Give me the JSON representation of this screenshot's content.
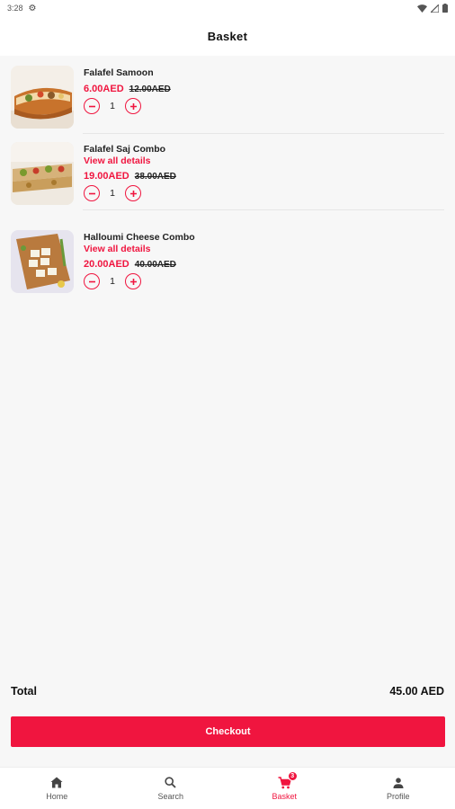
{
  "status_bar": {
    "time": "3:28"
  },
  "header": {
    "title": "Basket"
  },
  "items": [
    {
      "name": "Falafel Samoon",
      "details": "",
      "price": "6.00AED",
      "old_price": "12.00AED",
      "qty": "1",
      "image": "falafel-samoon-image"
    },
    {
      "name": "Falafel Saj Combo",
      "details": "View all details",
      "price": "19.00AED",
      "old_price": "38.00AED",
      "qty": "1",
      "image": "falafel-saj-combo-image"
    },
    {
      "name": "Halloumi Cheese Combo",
      "details": "View all details",
      "price": "20.00AED",
      "old_price": "40.00AED",
      "qty": "1",
      "image": "halloumi-cheese-combo-image"
    }
  ],
  "summary": {
    "total_label": "Total",
    "total_value": "45.00 AED"
  },
  "checkout_label": "Checkout",
  "nav": {
    "items": [
      {
        "label": "Home",
        "icon": "home-icon"
      },
      {
        "label": "Search",
        "icon": "search-icon"
      },
      {
        "label": "Basket",
        "icon": "basket-icon",
        "badge": "3"
      },
      {
        "label": "Profile",
        "icon": "profile-icon"
      }
    ],
    "active": "Basket"
  },
  "colors": {
    "accent": "#f0153f",
    "background": "#f7f7f7",
    "surface": "#ffffff"
  }
}
